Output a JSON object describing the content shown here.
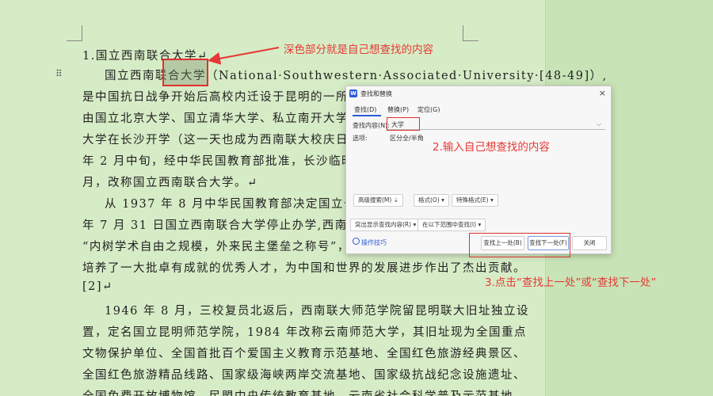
{
  "document": {
    "lines": [
      "1.国立西南联合大学↵",
      "国立西南联合大学（National·Southwestern·Associated·University·[48-49]）,",
      "是中国抗日战争开始后高校内迁设于昆明的一所综合性",
      "由国立北京大学、国立清华大学、私立南开大学在长沙",
      "大学在长沙开学（这一天也成为西南联大校庆日）。由于",
      "年 2 月中旬，经中华民国教育部批准，长沙临时大学分",
      "月，改称国立西南联合大学。↵",
      "从 1937 年 8 月中华民国教育部决定国立长沙临时",
      "年 7 月 31 日国立西南联合大学停止办学,西南联大前后",
      "“内树学术自由之规模，外来民主堡垒之称号”，保存了抗",
      "培养了一大批卓有成就的优秀人才，为中国和世界的发展进步作出了杰出贡献。",
      "[2]↵",
      "1946 年 8 月，三校复员北返后，西南联大师范学院留昆明联大旧址独立设",
      "置，定名国立昆明师范学院，1984 年改称云南师范大学，其旧址现为全国重点",
      "文物保护单位、全国首批百个爱国主义教育示范基地、全国红色旅游经典景区、",
      "全国红色旅游精品线路、国家级海峡两岸交流基地、国家级抗战纪念设施遗址、",
      "全国免费开放博物馆、民盟中央传统教育基地、云南省社会科学普及示范基地"
    ]
  },
  "annotations": {
    "highlighted_note": "深色部分就是自己想查找的内容",
    "input_note": "2.输入自己想查找的内容",
    "click_note": "3.点击“查找上一处”或“查找下一处”",
    "color": "#e53935"
  },
  "dialog": {
    "icon_text": "W",
    "title": "查找和替换",
    "close": "×",
    "tabs": [
      "查找(D)",
      "替换(P)",
      "定位(G)"
    ],
    "find_label": "查找内容(N):",
    "find_value": "大学",
    "options_label": "选项:",
    "options_value": "区分全/半角",
    "advanced_search": "高级搜索(M) ⇣",
    "format": "格式(O) ▾",
    "special_format": "特殊格式(E) ▾",
    "highlight_found": "突出显示查找内容(R) ▾",
    "search_in": "在以下范围中查找(I) ▾",
    "tips": "操作技巧",
    "find_prev": "查找上一处(B)",
    "find_next": "查找下一处(F)",
    "close_button": "关闭"
  }
}
